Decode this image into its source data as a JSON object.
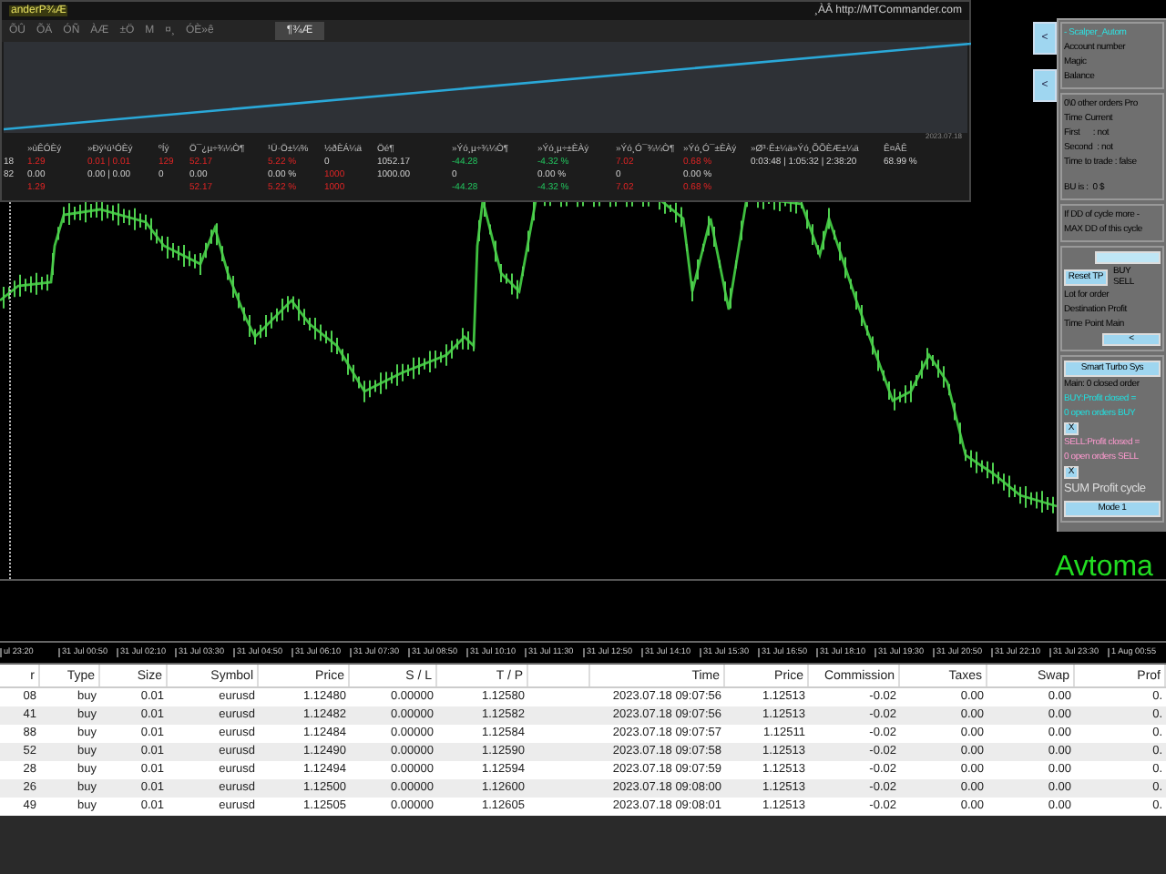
{
  "stats_panel": {
    "title": "anderP¾Æ",
    "link": "¸ÀÂ http://MTCommander.com",
    "tabs": [
      {
        "label": "ÕÛ",
        "selected": false
      },
      {
        "label": "ÕÄ",
        "selected": false
      },
      {
        "label": "ÓÑ",
        "selected": false
      },
      {
        "label": "ÀÆ",
        "selected": false
      },
      {
        "label": "±Ö",
        "selected": false
      },
      {
        "label": "M",
        "selected": false
      },
      {
        "label": "¤¸",
        "selected": false
      },
      {
        "label": "ÓÈ»ê",
        "selected": false
      },
      {
        "label": "¶¾Æ",
        "selected": true
      }
    ],
    "equity_date": "2023.07.18",
    "columns": [
      "",
      "»ùÊÓÈý",
      "»Ðý¹ú¹ÓÈý",
      "ºÍý",
      "Ö¯¿µ÷¾¼Ò¶",
      "¹Ü·Ö±¼%",
      "½ðÈÁ¼ä",
      "Öé¶",
      "»Ýó¸µ÷¾¼Ò¶",
      "»Ýó¸µ÷±ÈÀý",
      "»Ýó¸Ó¯¾¼Ò¶",
      "»Ýó¸Ó¯±ÈÀý",
      "»Ø³·Ê±¼ä»Ýó¸ÕÕÈÆ±¼ä",
      "Ê¤ÂÊ"
    ],
    "rows": [
      [
        {
          "kind": "plain",
          "text": "18"
        },
        {
          "kind": "loss",
          "text": "1.29"
        },
        {
          "kind": "loss",
          "text": "0.01 | 0.01"
        },
        {
          "kind": "loss",
          "text": "129"
        },
        {
          "kind": "loss",
          "text": "52.17"
        },
        {
          "kind": "loss",
          "text": "5.22 %"
        },
        {
          "kind": "plain",
          "text": "0"
        },
        {
          "kind": "plain",
          "text": "1052.17"
        },
        {
          "kind": "gain",
          "text": "-44.28"
        },
        {
          "kind": "gain",
          "text": "-4.32 %"
        },
        {
          "kind": "loss",
          "text": "7.02"
        },
        {
          "kind": "loss",
          "text": "0.68 %"
        },
        {
          "kind": "plain",
          "text": "0:03:48 | 1:05:32 | 2:38:20"
        },
        {
          "kind": "plain",
          "text": "68.99 %"
        }
      ],
      [
        {
          "kind": "plain",
          "text": "82"
        },
        {
          "kind": "plain",
          "text": "0.00"
        },
        {
          "kind": "plain",
          "text": "0.00 | 0.00"
        },
        {
          "kind": "plain",
          "text": "0"
        },
        {
          "kind": "plain",
          "text": "0.00"
        },
        {
          "kind": "plain",
          "text": "0.00 %"
        },
        {
          "kind": "loss",
          "text": "1000"
        },
        {
          "kind": "plain",
          "text": "1000.00"
        },
        {
          "kind": "plain",
          "text": "0"
        },
        {
          "kind": "plain",
          "text": "0.00 %"
        },
        {
          "kind": "plain",
          "text": "0"
        },
        {
          "kind": "plain",
          "text": "0.00 %"
        }
      ],
      [
        {
          "kind": "empty"
        },
        {
          "kind": "loss",
          "text": "1.29"
        },
        {
          "kind": "empty"
        },
        {
          "kind": "empty"
        },
        {
          "kind": "loss",
          "text": "52.17"
        },
        {
          "kind": "loss",
          "text": "5.22 %"
        },
        {
          "kind": "loss",
          "text": "1000"
        },
        {
          "kind": "empty"
        },
        {
          "kind": "gain",
          "text": "-44.28"
        },
        {
          "kind": "gain",
          "text": "-4.32 %"
        },
        {
          "kind": "loss",
          "text": "7.02"
        },
        {
          "kind": "loss",
          "text": "0.68 %"
        }
      ]
    ]
  },
  "side_buttons": [
    "<",
    "<"
  ],
  "side_panel": [
    [
      {
        "kind": "title",
        "text": "- Scalper_Autom"
      },
      {
        "kind": "text",
        "text": "Account number"
      },
      {
        "kind": "text",
        "text": "Magic"
      },
      {
        "kind": "text",
        "text": "Balance"
      }
    ],
    [
      {
        "kind": "text",
        "text": "0\\0 other orders Pro"
      },
      {
        "kind": "text",
        "text": "Time Current"
      },
      {
        "kind": "text",
        "text": "First      : not"
      },
      {
        "kind": "text",
        "text": "Second  : not"
      },
      {
        "kind": "text",
        "text": "Time to trade : false"
      },
      {
        "kind": "spacer"
      },
      {
        "kind": "text",
        "text": "BU is :  0 $"
      }
    ],
    [
      {
        "kind": "text",
        "text": "If DD of cycle more -"
      },
      {
        "kind": "text",
        "text": "MAX DD of this cycle"
      }
    ],
    [
      {
        "kind": "blank_button"
      },
      {
        "kind": "button_row",
        "text": "Reset TP",
        "labels": [
          "BUY",
          "SELL"
        ]
      },
      {
        "kind": "text",
        "text": "Lot for order"
      },
      {
        "kind": "text",
        "text": "Destination Profit"
      },
      {
        "kind": "text",
        "text": "Time Point Main"
      },
      {
        "kind": "nav_button",
        "text": "<"
      }
    ],
    [
      {
        "kind": "button",
        "text": "Smart Turbo Sys"
      },
      {
        "kind": "text",
        "text": "Main: 0 closed order"
      },
      {
        "kind": "buy",
        "text": "BUY:Profit closed ="
      },
      {
        "kind": "buy",
        "text": "0 open orders BUY"
      },
      {
        "kind": "small_button",
        "text": "X"
      },
      {
        "kind": "sell",
        "text": "SELL:Profit closed ="
      },
      {
        "kind": "sell",
        "text": "0 open orders SELL"
      },
      {
        "kind": "small_button",
        "text": "X"
      },
      {
        "kind": "big",
        "text": "SUM Profit cycle"
      },
      {
        "kind": "button",
        "text": "Mode 1"
      }
    ]
  ],
  "chart_label": "Avtoma",
  "time_axis": [
    "ul 23:20",
    "31 Jul 00:50",
    "31 Jul 02:10",
    "31 Jul 03:30",
    "31 Jul 04:50",
    "31 Jul 06:10",
    "31 Jul 07:30",
    "31 Jul 08:50",
    "31 Jul 10:10",
    "31 Jul 11:30",
    "31 Jul 12:50",
    "31 Jul 14:10",
    "31 Jul 15:30",
    "31 Jul 16:50",
    "31 Jul 18:10",
    "31 Jul 19:30",
    "31 Jul 20:50",
    "31 Jul 22:10",
    "31 Jul 23:30",
    "1 Aug 00:55"
  ],
  "trades": {
    "columns": [
      "r",
      "Type",
      "Size",
      "Symbol",
      "Price",
      "S / L",
      "T / P",
      "",
      "Time",
      "Price",
      "Commission",
      "Taxes",
      "Swap",
      "Prof"
    ],
    "rows": [
      [
        "08",
        "buy",
        "0.01",
        "eurusd",
        "1.12480",
        "0.00000",
        "1.12580",
        "",
        "2023.07.18 09:07:56",
        "1.12513",
        "-0.02",
        "0.00",
        "0.00",
        "0."
      ],
      [
        "41",
        "buy",
        "0.01",
        "eurusd",
        "1.12482",
        "0.00000",
        "1.12582",
        "",
        "2023.07.18 09:07:56",
        "1.12513",
        "-0.02",
        "0.00",
        "0.00",
        "0."
      ],
      [
        "88",
        "buy",
        "0.01",
        "eurusd",
        "1.12484",
        "0.00000",
        "1.12584",
        "",
        "2023.07.18 09:07:57",
        "1.12511",
        "-0.02",
        "0.00",
        "0.00",
        "0."
      ],
      [
        "52",
        "buy",
        "0.01",
        "eurusd",
        "1.12490",
        "0.00000",
        "1.12590",
        "",
        "2023.07.18 09:07:58",
        "1.12513",
        "-0.02",
        "0.00",
        "0.00",
        "0."
      ],
      [
        "28",
        "buy",
        "0.01",
        "eurusd",
        "1.12494",
        "0.00000",
        "1.12594",
        "",
        "2023.07.18 09:07:59",
        "1.12513",
        "-0.02",
        "0.00",
        "0.00",
        "0."
      ],
      [
        "26",
        "buy",
        "0.01",
        "eurusd",
        "1.12500",
        "0.00000",
        "1.12600",
        "",
        "2023.07.18 09:08:00",
        "1.12513",
        "-0.02",
        "0.00",
        "0.00",
        "0."
      ],
      [
        "49",
        "buy",
        "0.01",
        "eurusd",
        "1.12505",
        "0.00000",
        "1.12605",
        "",
        "2023.07.18 09:08:01",
        "1.12513",
        "-0.02",
        "0.00",
        "0.00",
        "0."
      ]
    ]
  }
}
